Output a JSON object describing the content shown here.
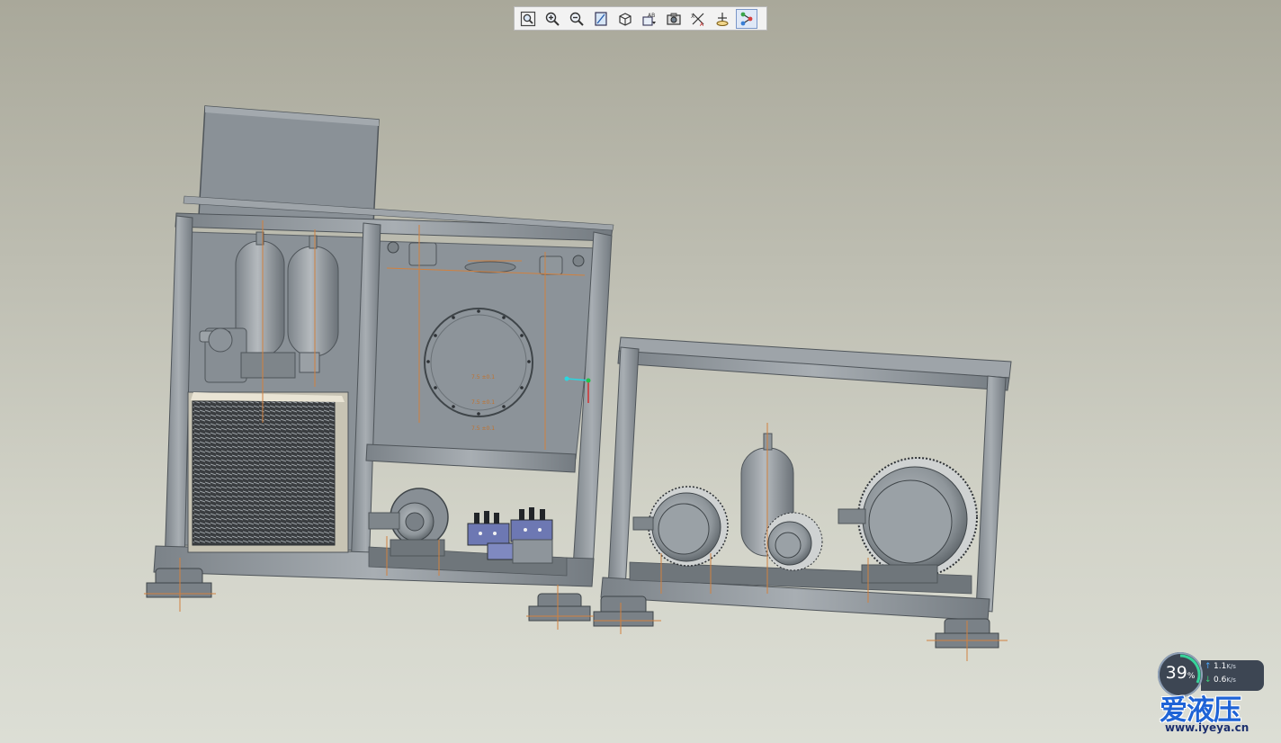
{
  "toolbar": {
    "buttons": [
      {
        "icon": "zoom-fit-icon"
      },
      {
        "icon": "zoom-in-icon"
      },
      {
        "icon": "zoom-out-icon"
      },
      {
        "icon": "zoom-area-icon"
      },
      {
        "icon": "view-cube-icon"
      },
      {
        "icon": "named-views-icon"
      },
      {
        "icon": "capture-icon"
      },
      {
        "icon": "datum-display-icon"
      },
      {
        "icon": "spin-center-icon"
      },
      {
        "icon": "model-tree-icon",
        "active": true
      }
    ]
  },
  "model": {
    "hole_labels": [
      "7.5 ±0.1",
      "7.5 ±0.1",
      "7.5 ±0.1"
    ]
  },
  "network_widget": {
    "cpu_percent": "39",
    "percent_sign": "%",
    "upload_rate": "1.1",
    "upload_unit": "K/s",
    "download_rate": "0.6",
    "download_unit": "K/s",
    "up_arrow": "↑",
    "down_arrow": "↓"
  },
  "watermark": {
    "logo": "爱液压",
    "url": "www.iyeya.cn"
  },
  "colors": {
    "metal": "#8e959b",
    "metal_dark": "#5b6166",
    "annotation_orange": "#d1813f",
    "valve_blue": "#6d78b3",
    "accent_blue": "#1e63d6"
  }
}
